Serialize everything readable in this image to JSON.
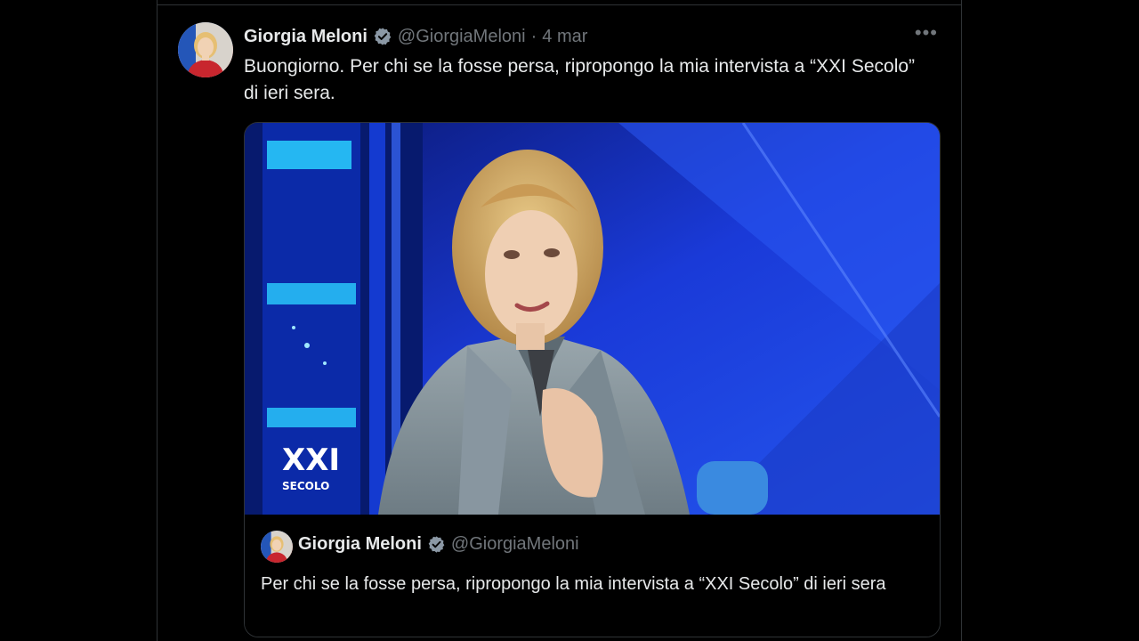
{
  "tweet": {
    "author_name": "Giorgia Meloni",
    "handle": "@GiorgiaMeloni",
    "separator": "·",
    "date": "4 mar",
    "more_label": "•••",
    "text": "Buongiorno. Per chi se la fosse persa, ripropongo la mia intervista a “XXI Secolo” di ieri sera."
  },
  "quoted_tweet": {
    "author_name": "Giorgia Meloni",
    "handle": "@GiorgiaMeloni",
    "text": "Per chi se la fosse persa, ripropongo la mia intervista a “XXI Secolo” di ieri sera"
  },
  "media": {
    "logo_line1": "XXI",
    "logo_line2": "SECOLO"
  },
  "colors": {
    "background": "#000000",
    "text": "#e7e9ea",
    "secondary_text": "#71767b",
    "verified_badge": "#8b98a5",
    "border": "#2f3336"
  },
  "icons": {
    "verified": "verified-badge-icon",
    "more": "more-options-icon"
  }
}
